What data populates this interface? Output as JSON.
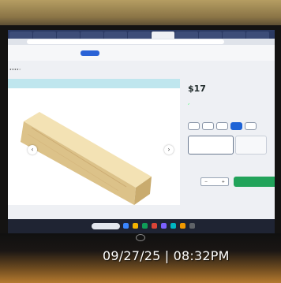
{
  "browser": {
    "tabs": [
      "",
      "",
      "",
      "",
      "",
      "",
      "",
      "",
      "",
      "",
      "",
      ""
    ]
  },
  "store_bar": {
    "note": "",
    "button": ""
  },
  "gallery": {
    "header_right": ""
  },
  "panel": {
    "price_caption": "",
    "price_main": "$17",
    "price_cents": "",
    "length_label": "",
    "length_options": [
      "",
      "",
      "",
      "",
      ""
    ],
    "add_to_cart": ""
  },
  "taskbar": {
    "search": "",
    "icon_colors": [
      "#3a86ff",
      "#f4b400",
      "#0f9d58",
      "#db4437",
      "#7b61ff",
      "#00b7c3",
      "#f29900",
      "#5f6368"
    ]
  },
  "timestamp": "09/27/25 | 08:32PM"
}
